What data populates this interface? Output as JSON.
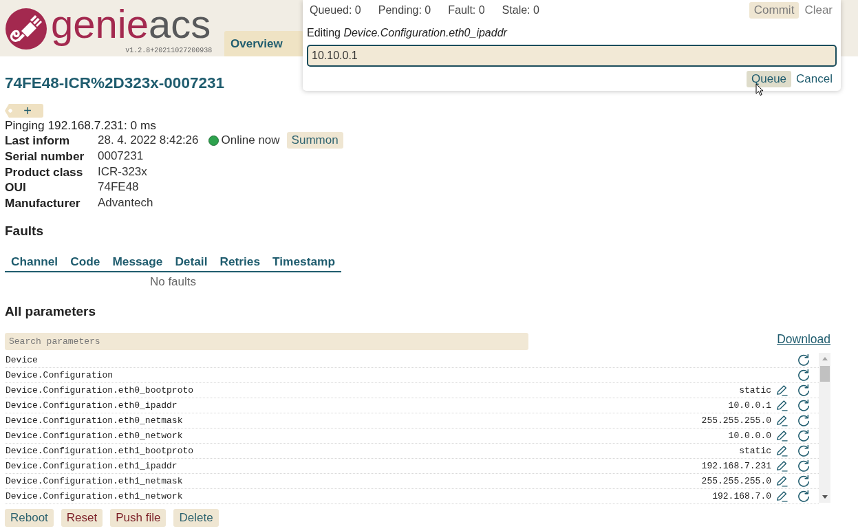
{
  "header": {
    "logo": [
      {
        "text": "genie",
        "color": "#a3294f"
      },
      {
        "text": "acs",
        "color": "#58595b"
      }
    ],
    "version": "v1.2.8+20211027200938",
    "tabs": [
      {
        "label": "Overview",
        "selected": true
      }
    ]
  },
  "queue_popup": {
    "counts": [
      "Queued: 0",
      "Pending: 0",
      "Fault: 0",
      "Stale: 0"
    ],
    "top_actions": [
      {
        "label": "Commit",
        "kind": "button",
        "disabled": true,
        "hovered": false
      },
      {
        "label": "Clear",
        "kind": "link",
        "disabled": true,
        "hovered": false
      }
    ],
    "editing": "Editing *Device.Configuration.eth0_ipaddr*",
    "value": "10.10.0.1",
    "bottom_actions": [
      {
        "label": "Queue",
        "kind": "button",
        "disabled": false,
        "hovered": true
      },
      {
        "label": "Cancel",
        "kind": "link",
        "disabled": false,
        "hovered": false
      }
    ]
  },
  "device": {
    "title": "74FE48-ICR%2D323x-0007231",
    "tag_add": "+",
    "ping": "Pinging 192.168.7.231: 0 ms",
    "properties": [
      {
        "kind": "inform",
        "label": "Last inform",
        "value": "28. 4. 2022 8:42:26",
        "online": true,
        "status": "Online now",
        "action": "Summon"
      },
      {
        "kind": "plain",
        "label": "Serial number",
        "value": "0007231"
      },
      {
        "kind": "plain",
        "label": "Product class",
        "value": "ICR-323x"
      },
      {
        "kind": "plain",
        "label": "OUI",
        "value": "74FE48"
      },
      {
        "kind": "plain",
        "label": "Manufacturer",
        "value": "Advantech"
      }
    ]
  },
  "faults": {
    "title": "Faults",
    "columns": [
      "Channel",
      "Code",
      "Message",
      "Detail",
      "Retries",
      "Timestamp"
    ],
    "empty_text": "No faults"
  },
  "parameters": {
    "title": "All parameters",
    "search": {
      "placeholder": "Search parameters"
    },
    "download": "Download",
    "rows": [
      {
        "name": "Device",
        "editable": false
      },
      {
        "name": "Device.Configuration",
        "editable": false
      },
      {
        "name": "Device.Configuration.eth0_bootproto",
        "value": "static",
        "editable": true
      },
      {
        "name": "Device.Configuration.eth0_ipaddr",
        "value": "10.0.0.1",
        "editable": true
      },
      {
        "name": "Device.Configuration.eth0_netmask",
        "value": "255.255.255.0",
        "editable": true
      },
      {
        "name": "Device.Configuration.eth0_network",
        "value": "10.0.0.0",
        "editable": true
      },
      {
        "name": "Device.Configuration.eth1_bootproto",
        "value": "static",
        "editable": true
      },
      {
        "name": "Device.Configuration.eth1_ipaddr",
        "value": "192.168.7.231",
        "editable": true
      },
      {
        "name": "Device.Configuration.eth1_netmask",
        "value": "255.255.255.0",
        "editable": true
      },
      {
        "name": "Device.Configuration.eth1_network",
        "value": "192.168.7.0",
        "editable": true
      }
    ]
  },
  "buttons": [
    {
      "label": "Reboot",
      "kind": "normal"
    },
    {
      "label": "Reset",
      "kind": "danger"
    },
    {
      "label": "Push file",
      "kind": "danger"
    },
    {
      "label": "Delete",
      "kind": "normal"
    }
  ]
}
